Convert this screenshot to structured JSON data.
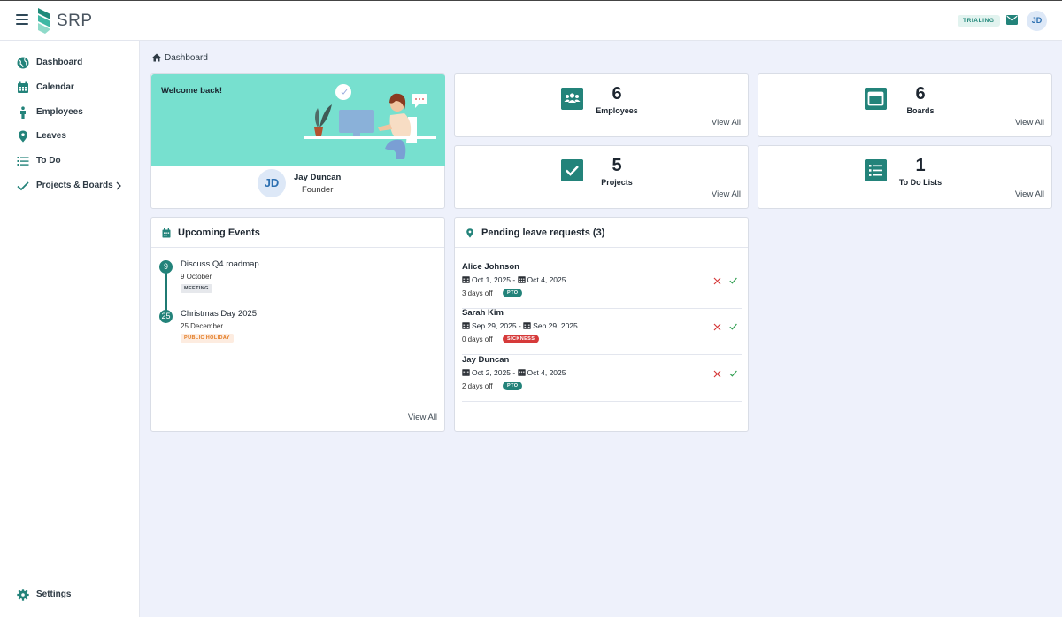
{
  "header": {
    "logo_text": "SRP",
    "trial_badge": "TRIALING",
    "user_initials": "JD"
  },
  "sidebar": {
    "items": [
      {
        "label": "Dashboard",
        "icon": "globe-icon"
      },
      {
        "label": "Calendar",
        "icon": "calendar-icon"
      },
      {
        "label": "Employees",
        "icon": "person-icon"
      },
      {
        "label": "Leaves",
        "icon": "map-pin-icon"
      },
      {
        "label": "To Do",
        "icon": "list-icon"
      },
      {
        "label": "Projects & Boards",
        "icon": "check-icon"
      }
    ],
    "settings_label": "Settings"
  },
  "breadcrumb": "Dashboard",
  "welcome": {
    "greeting": "Welcome back!",
    "initials": "JD",
    "name": "Jay Duncan",
    "role": "Founder"
  },
  "stats": [
    {
      "value": "6",
      "label": "Employees",
      "link": "View All",
      "icon": "users-icon"
    },
    {
      "value": "6",
      "label": "Boards",
      "link": "View All",
      "icon": "board-icon"
    },
    {
      "value": "5",
      "label": "Projects",
      "link": "View All",
      "icon": "checkbox-icon"
    },
    {
      "value": "1",
      "label": "To Do Lists",
      "link": "View All",
      "icon": "list-icon"
    }
  ],
  "events": {
    "title": "Upcoming Events",
    "items": [
      {
        "day": "9",
        "title": "Discuss Q4 roadmap",
        "date": "9 October",
        "tag": "MEETING"
      },
      {
        "day": "25",
        "title": "Christmas Day 2025",
        "date": "25 December",
        "tag": "PUBLIC HOLIDAY"
      }
    ],
    "view_all": "View All"
  },
  "leaves": {
    "title": "Pending leave requests (3)",
    "items": [
      {
        "name": "Alice Johnson",
        "start": "Oct 1, 2025",
        "end": "Oct 4, 2025",
        "days": "3 days off",
        "type": "PTO"
      },
      {
        "name": "Sarah Kim",
        "start": "Sep 29, 2025",
        "end": "Sep 29, 2025",
        "days": "0 days off",
        "type": "SICKNESS"
      },
      {
        "name": "Jay Duncan",
        "start": "Oct 2, 2025",
        "end": "Oct 4, 2025",
        "days": "2 days off",
        "type": "PTO"
      }
    ],
    "separator": "-"
  },
  "colors": {
    "accent": "#23837a",
    "banner": "#77e0cf",
    "background": "#eef1fb",
    "pto": "#23837a",
    "sickness": "#d63a3a"
  }
}
